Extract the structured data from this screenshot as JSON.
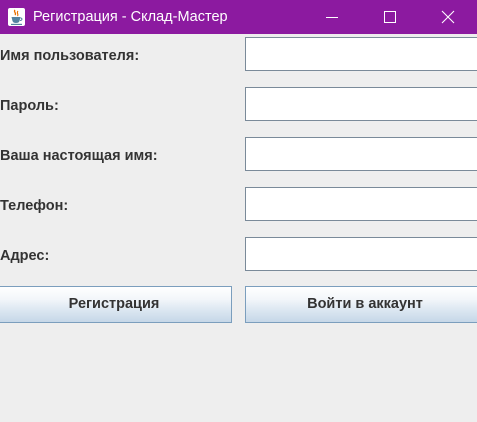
{
  "window": {
    "title": "Регистрация - Склад-Мастер",
    "titlebar_color": "#8c1aa0",
    "app_icon": "java-coffee-cup-icon",
    "controls": {
      "minimize": "minimize-icon",
      "maximize": "maximize-icon",
      "close": "close-icon"
    }
  },
  "form": {
    "fields": [
      {
        "label": "Имя пользователя:",
        "value": ""
      },
      {
        "label": "Пароль:",
        "value": ""
      },
      {
        "label": "Ваша настоящая имя:",
        "value": ""
      },
      {
        "label": "Телефон:",
        "value": ""
      },
      {
        "label": "Адрес:",
        "value": ""
      }
    ],
    "register_label": "Регистрация",
    "login_label": "Войти в аккаунт"
  }
}
